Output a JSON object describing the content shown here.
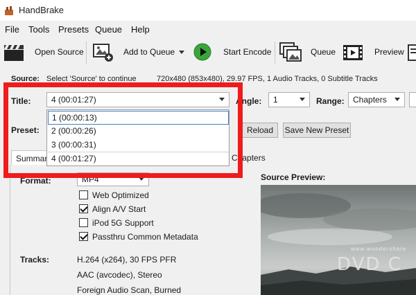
{
  "window": {
    "title": "HandBrake"
  },
  "menu": [
    "File",
    "Tools",
    "Presets",
    "Queue",
    "Help"
  ],
  "toolbar": {
    "open_source": "Open Source",
    "add_to_queue": "Add to Queue",
    "start_encode": "Start Encode",
    "queue": "Queue",
    "preview": "Preview"
  },
  "source": {
    "label": "Source:",
    "prompt": "Select 'Source' to continue",
    "info": "720x480 (853x480), 29.97 FPS, 1 Audio Tracks, 0 Subtitle Tracks"
  },
  "title_row": {
    "label": "Title:",
    "value": "4  (00:01:27)",
    "angle_label": "Angle:",
    "angle_value": "1",
    "range_label": "Range:",
    "range_value": "Chapters"
  },
  "title_options": [
    "1  (00:00:13)",
    "2  (00:00:26)",
    "3  (00:00:31)",
    "4  (00:01:27)"
  ],
  "preset": {
    "label": "Preset:",
    "reload": "Reload",
    "save_new": "Save New Preset"
  },
  "tabs": {
    "summary": "Summary",
    "chapters": "Chapters"
  },
  "summary": {
    "format_label": "Format:",
    "format_value": "MP4",
    "options": [
      {
        "label": "Web Optimized",
        "checked": false
      },
      {
        "label": "Align A/V Start",
        "checked": true
      },
      {
        "label": "iPod 5G Support",
        "checked": false
      },
      {
        "label": "Passthru Common Metadata",
        "checked": true
      }
    ],
    "tracks_label": "Tracks:",
    "tracks": [
      "H.264 (x264), 30 FPS PFR",
      "AAC (avcodec), Stereo",
      "Foreign Audio Scan, Burned"
    ]
  },
  "preview": {
    "label": "Source Preview:",
    "watermark": "DVD C",
    "small_text": "www.wondershare"
  },
  "colors": {
    "highlight": "#ee1c1c",
    "accent": "#3f7ec9",
    "play": "#3aa63a"
  }
}
